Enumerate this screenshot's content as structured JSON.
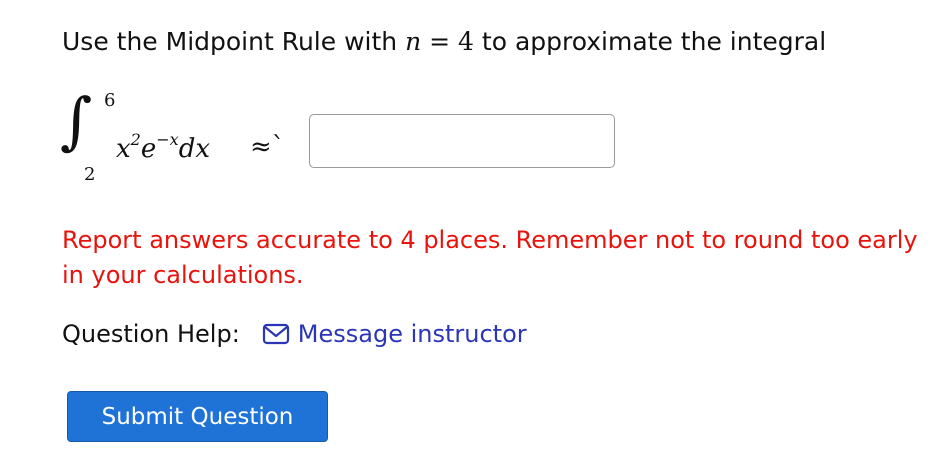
{
  "question": {
    "intro_prefix": "Use the Midpoint Rule with",
    "intro_var": "n",
    "intro_eq": "=",
    "intro_n_value": "4",
    "intro_suffix": "to approximate the integral",
    "integral": {
      "sign": "∫",
      "upper_limit": "6",
      "lower_limit": "2",
      "base_var": "x",
      "base_exp": "2",
      "exp_base": "e",
      "exp_exp": "−x",
      "differential": "dx",
      "approx_symbol": "≈`"
    },
    "answer_input": {
      "value": "",
      "placeholder": ""
    },
    "warning_text": "Report answers accurate to 4 places. Remember not to round too early in your calculations."
  },
  "help": {
    "label": "Question Help:",
    "icon": "mail-icon",
    "link_text": "Message instructor",
    "link_color": "#2b35b8"
  },
  "submit": {
    "label": "Submit Question",
    "color": "#1f73d6"
  },
  "colors": {
    "warning": "#e8130c",
    "text": "#111111"
  }
}
